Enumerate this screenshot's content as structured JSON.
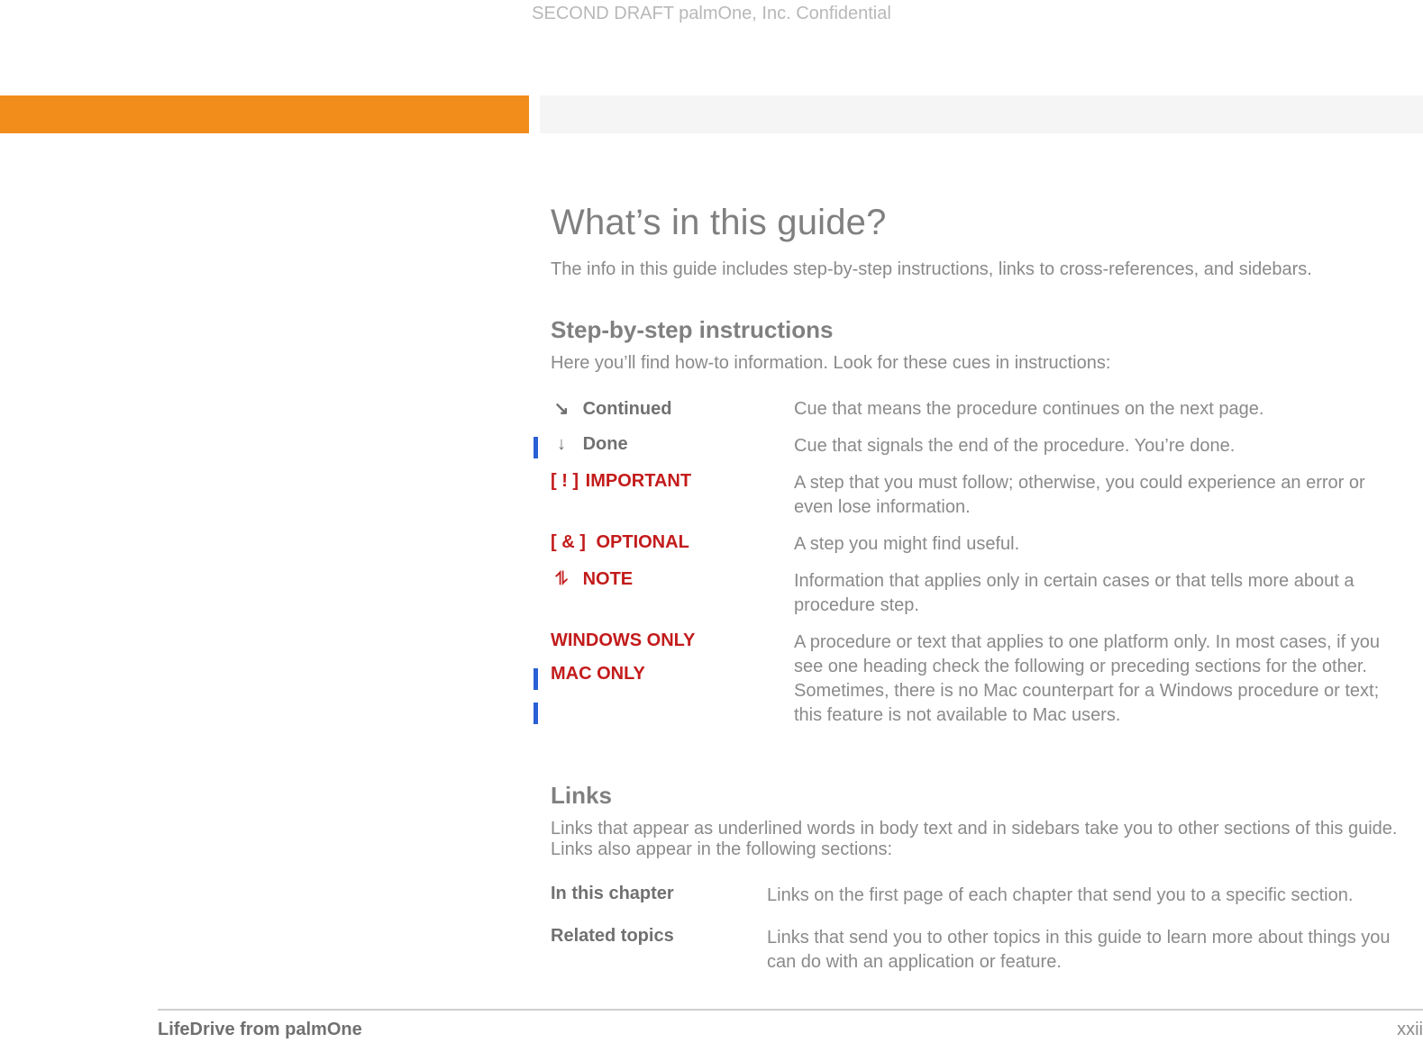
{
  "confidential": "SECOND DRAFT palmOne, Inc.  Confidential",
  "title": "What’s in this guide?",
  "intro": "The info in this guide includes step-by-step instructions, links to cross-references, and sidebars.",
  "steps": {
    "heading": "Step-by-step instructions",
    "intro": "Here you’ll find how-to information. Look for these cues in instructions:",
    "rows": [
      {
        "icon": "↘",
        "iconClass": "gray",
        "label": "Continued",
        "labelClass": "graybold",
        "desc": "Cue that means the procedure continues on the next page."
      },
      {
        "icon": "↓",
        "iconClass": "gray",
        "label": "Done",
        "labelClass": "graybold",
        "desc": "Cue that signals the end of the procedure. You’re done."
      },
      {
        "icon": "[ ! ]",
        "iconClass": "red",
        "label": "IMPORTANT",
        "labelClass": "red",
        "desc": "A step that you must follow; otherwise, you could experience an error or even lose information."
      },
      {
        "icon": "[ & ]",
        "iconClass": "red",
        "label": "OPTIONAL",
        "labelClass": "red",
        "desc": "A step you might find useful."
      },
      {
        "icon": "⥮",
        "iconClass": "red",
        "label": "NOTE",
        "labelClass": "red",
        "desc": "Information that applies only in certain cases or that tells more about a procedure step."
      },
      {
        "icon": "",
        "iconClass": "",
        "label": "WINDOWS ONLY",
        "labelClass": "red",
        "label2": "MAC ONLY",
        "desc": "A procedure or text that applies to one platform only. In most cases, if you see one heading check the following or preceding sections for the other. Sometimes, there is no Mac counterpart for a Windows procedure or text; this feature is not available to Mac users."
      }
    ]
  },
  "links": {
    "heading": "Links",
    "intro": "Links that appear as underlined words in body text and in sidebars take you to other sections of this guide. Links also appear in the following sections:",
    "rows": [
      {
        "label": "In this chapter",
        "desc": "Links on the first page of each chapter that send you to a specific section."
      },
      {
        "label": "Related topics",
        "desc": "Links that send you to other topics in this guide to learn more about things you can do with an application or feature."
      }
    ]
  },
  "footer": {
    "left": "LifeDrive from palmOne",
    "right": "xxii"
  }
}
